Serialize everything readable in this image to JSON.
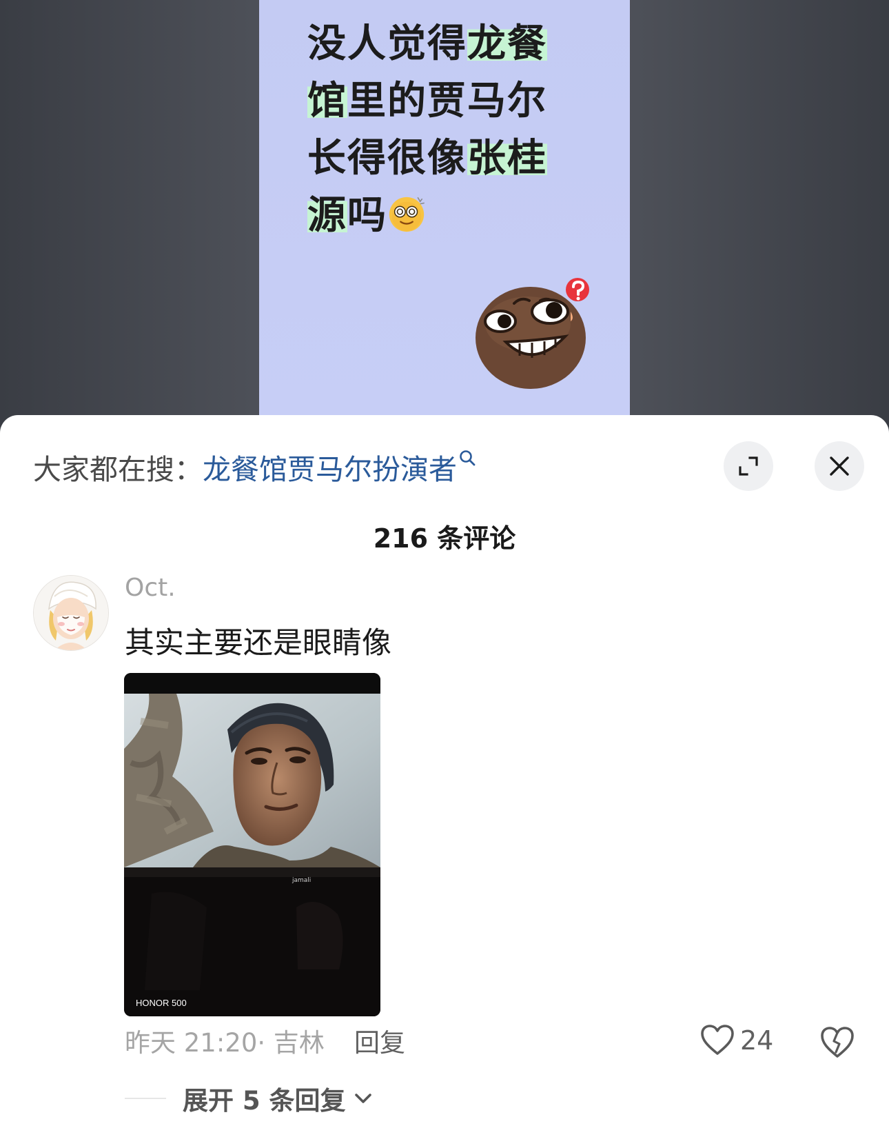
{
  "post": {
    "lines": [
      [
        {
          "text": "没人觉得",
          "hl": false
        },
        {
          "text": "龙餐",
          "hl": true
        }
      ],
      [
        {
          "text": "馆",
          "hl": true
        },
        {
          "text": "里的贾马尔",
          "hl": false
        }
      ],
      [
        {
          "text": "长得很像",
          "hl": false
        },
        {
          "text": "张桂",
          "hl": true
        }
      ],
      [
        {
          "text": "源",
          "hl": true
        },
        {
          "text": "吗",
          "hl": false
        }
      ]
    ],
    "inline_emoji": "dazed-face-icon",
    "sticker": "confused-grin-sticker"
  },
  "sheet": {
    "search_prefix": "大家都在搜：",
    "search_query": "龙餐馆贾马尔扮演者",
    "expand_icon": "expand-icon",
    "close_icon": "close-icon",
    "comment_count": "216 条评论"
  },
  "comment": {
    "username": "Oct.",
    "text": "其实主要还是眼睛像",
    "image_caption": "jamali",
    "image_watermark": "HONOR 500",
    "time": "昨天 21:20",
    "location": "· 吉林",
    "reply_label": "回复",
    "likes": "24",
    "expand_replies": "展开 5 条回复"
  },
  "colors": {
    "card_bg": "#c6cdf5",
    "highlight": "#c6f4d3",
    "link": "#2a5a9a"
  }
}
